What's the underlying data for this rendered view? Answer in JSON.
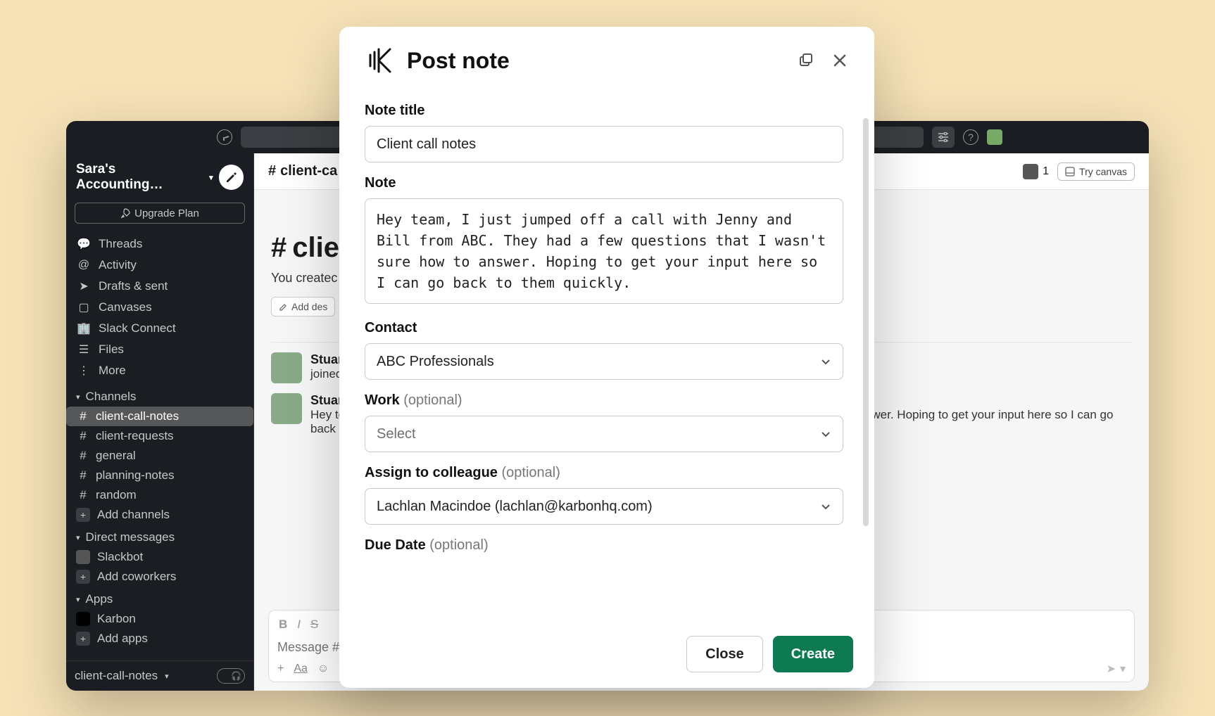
{
  "topbar": {
    "help_tooltip": "?"
  },
  "workspace": {
    "name": "Sara's Accounting…",
    "upgrade_label": "Upgrade Plan"
  },
  "sidebar": {
    "nav": [
      {
        "label": "Threads",
        "icon": "threads-icon"
      },
      {
        "label": "Activity",
        "icon": "at-icon"
      },
      {
        "label": "Drafts & sent",
        "icon": "send-icon"
      },
      {
        "label": "Canvases",
        "icon": "canvas-icon"
      },
      {
        "label": "Slack Connect",
        "icon": "building-icon"
      },
      {
        "label": "Files",
        "icon": "stack-icon"
      },
      {
        "label": "More",
        "icon": "more-icon"
      }
    ],
    "channels_header": "Channels",
    "channels": [
      {
        "name": "client-call-notes",
        "active": true
      },
      {
        "name": "client-requests"
      },
      {
        "name": "general"
      },
      {
        "name": "planning-notes"
      },
      {
        "name": "random"
      }
    ],
    "add_channels": "Add channels",
    "dms_header": "Direct messages",
    "dms": [
      {
        "name": "Slackbot"
      }
    ],
    "add_coworkers": "Add coworkers",
    "apps_header": "Apps",
    "apps": [
      {
        "name": "Karbon"
      }
    ],
    "add_apps": "Add apps",
    "footer_channel": "client-call-notes"
  },
  "channel": {
    "header_name": "client-ca",
    "member_count": "1",
    "try_canvas": "Try canvas",
    "intro_title": "clien",
    "intro_sub": "You createc",
    "add_description": "Add des",
    "msgs": [
      {
        "name": "Stuart",
        "text": "joined t"
      },
      {
        "name": "Stuart",
        "text_a": "Hey te",
        "text_b": "answer. Hoping to get your input here so I can go",
        "text_c": "back t"
      }
    ],
    "composer_placeholder": "Message #"
  },
  "modal": {
    "title": "Post note",
    "note_title_label": "Note title",
    "note_title_value": "Client call notes",
    "note_label": "Note",
    "note_value": "Hey team, I just jumped off a call with Jenny and Bill from ABC. They had a few questions that I wasn't sure how to answer. Hoping to get your input here so I can go back to them quickly.",
    "contact_label": "Contact",
    "contact_value": "ABC Professionals",
    "work_label": "Work",
    "work_optional": "(optional)",
    "work_value": "Select",
    "assign_label": "Assign to colleague",
    "assign_optional": "(optional)",
    "assign_value": "Lachlan Macindoe (lachlan@karbonhq.com)",
    "due_label": "Due Date",
    "due_optional": "(optional)",
    "close_label": "Close",
    "create_label": "Create"
  }
}
